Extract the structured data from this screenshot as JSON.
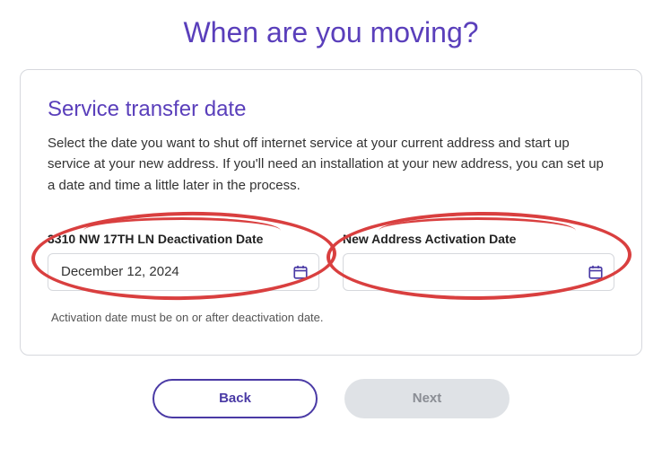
{
  "page_title": "When are you moving?",
  "card": {
    "section_title": "Service transfer date",
    "description": "Select the date you want to shut off internet service at your current address and start up service at your new address. If you'll need an installation at your new address, you can set up a date and time a little later in the process.",
    "deactivation": {
      "label": "3310 NW 17TH LN Deactivation Date",
      "value": "December 12, 2024"
    },
    "activation": {
      "label": "New Address Activation Date",
      "value": ""
    },
    "hint": "Activation date must be on or after deactivation date."
  },
  "buttons": {
    "back": "Back",
    "next": "Next"
  },
  "colors": {
    "accent": "#5a3fbb",
    "annotation": "#d93f3f"
  }
}
